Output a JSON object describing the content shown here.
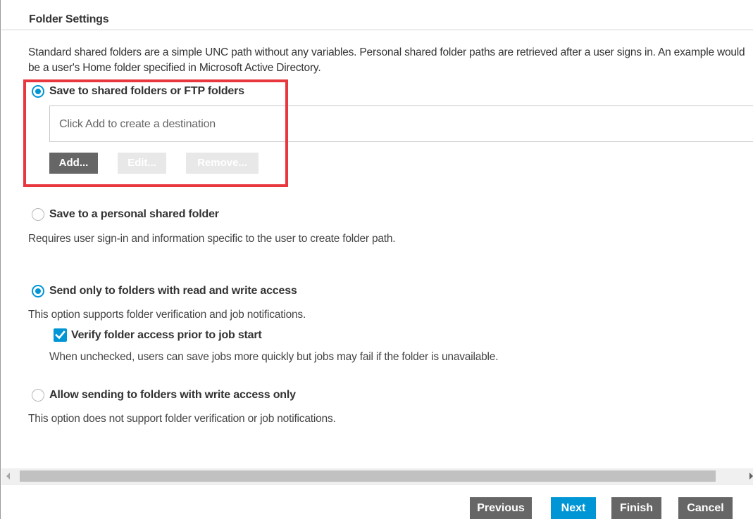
{
  "header": {
    "title": "Folder Settings"
  },
  "description": "Standard shared folders are a simple UNC path without any variables. Personal shared folder paths are retrieved after a user signs in. An example would be a user's Home folder specified in Microsoft Active Directory.",
  "save_options": {
    "shared": {
      "label": "Save to shared folders or FTP folders",
      "selected": true
    },
    "destination_placeholder": "Click Add to create a destination",
    "buttons": {
      "add": "Add...",
      "edit": "Edit...",
      "remove": "Remove..."
    },
    "personal": {
      "label": "Save to a personal shared folder",
      "selected": false,
      "description": "Requires user sign-in and information specific to the user to create folder path."
    }
  },
  "access_options": {
    "read_write": {
      "label": "Send only to folders with read and write access",
      "selected": true,
      "description": "This option supports folder verification and job notifications."
    },
    "verify": {
      "label": "Verify folder access prior to job start",
      "checked": true,
      "description": "When unchecked, users can save jobs more quickly but jobs may fail if the folder is unavailable."
    },
    "write_only": {
      "label": "Allow sending to folders with write access only",
      "selected": false,
      "description": "This option does not support folder verification or job notifications."
    }
  },
  "footer": {
    "previous": "Previous",
    "next": "Next",
    "finish": "Finish",
    "cancel": "Cancel"
  },
  "colors": {
    "accent": "#0096d6",
    "highlight": "#e8373f",
    "button_dark": "#666666",
    "button_disabled": "#e8e8e8"
  }
}
